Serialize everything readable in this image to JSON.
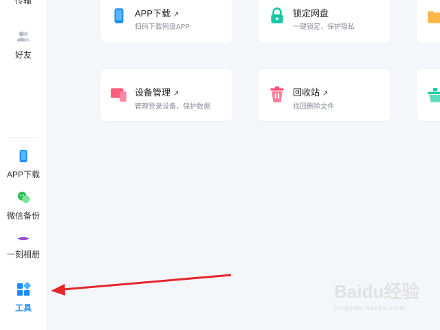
{
  "sidebar": {
    "items": [
      {
        "label": "传输"
      },
      {
        "label": "好友"
      },
      {
        "label": "APP下载"
      },
      {
        "label": "微信备份"
      },
      {
        "label": "一刻相册"
      },
      {
        "label": "工具"
      }
    ]
  },
  "tools": [
    {
      "title": "APP下载",
      "desc": "扫码下载网盘APP"
    },
    {
      "title": "锁定网盘",
      "desc": "一键锁定，保护隐私"
    },
    {
      "title": "设备管理",
      "desc": "管理登录设备，保护数据"
    },
    {
      "title": "回收站",
      "desc": "找回删除文件"
    }
  ],
  "watermark": {
    "brand": "Baidu经验",
    "url": "jingyan.baidu.com"
  },
  "colors": {
    "accent": "#1a8cff",
    "arrow": "#e5262b"
  }
}
